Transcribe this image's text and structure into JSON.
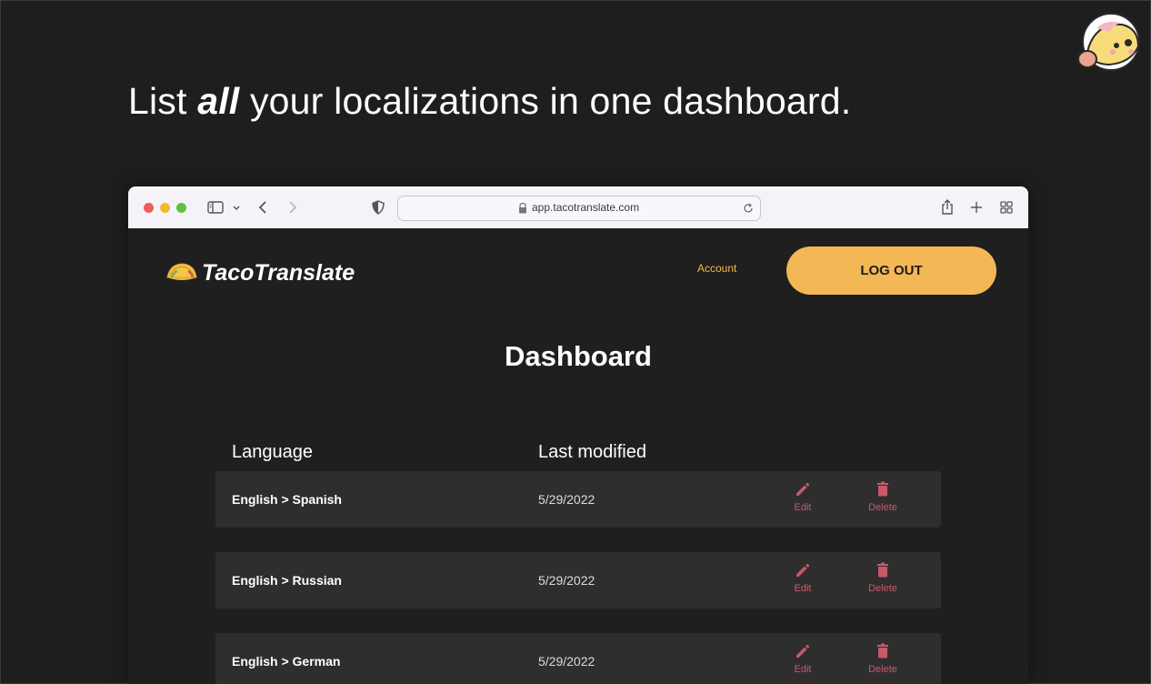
{
  "headline": {
    "before": "List ",
    "emphasis": "all",
    "after": " your localizations in one dashboard."
  },
  "browser": {
    "url": "app.tacotranslate.com",
    "toolbar_icons": [
      "sidebar-icon",
      "chevron-down-icon",
      "back-icon",
      "forward-icon",
      "shield-icon",
      "lock-icon",
      "reload-icon",
      "share-icon",
      "new-tab-icon",
      "tab-overview-icon"
    ],
    "traffic_light_colors": [
      "#ee5d57",
      "#f2bb2e",
      "#5fc23d"
    ]
  },
  "app": {
    "brand": "TacoTranslate",
    "nav": {
      "account": "Account",
      "logout": "LOG OUT"
    },
    "title": "Dashboard",
    "table": {
      "headers": {
        "language": "Language",
        "modified": "Last modified"
      },
      "rows": [
        {
          "language": "English > Spanish",
          "modified": "5/29/2022",
          "edit": "Edit",
          "delete": "Delete"
        },
        {
          "language": "English > Russian",
          "modified": "5/29/2022",
          "edit": "Edit",
          "delete": "Delete"
        },
        {
          "language": "English > German",
          "modified": "5/29/2022",
          "edit": "Edit",
          "delete": "Delete"
        }
      ]
    }
  },
  "colors": {
    "accent": "#f4b756",
    "danger": "#c9596a",
    "background": "#1e1e1e",
    "row": "#2e2e2e"
  }
}
